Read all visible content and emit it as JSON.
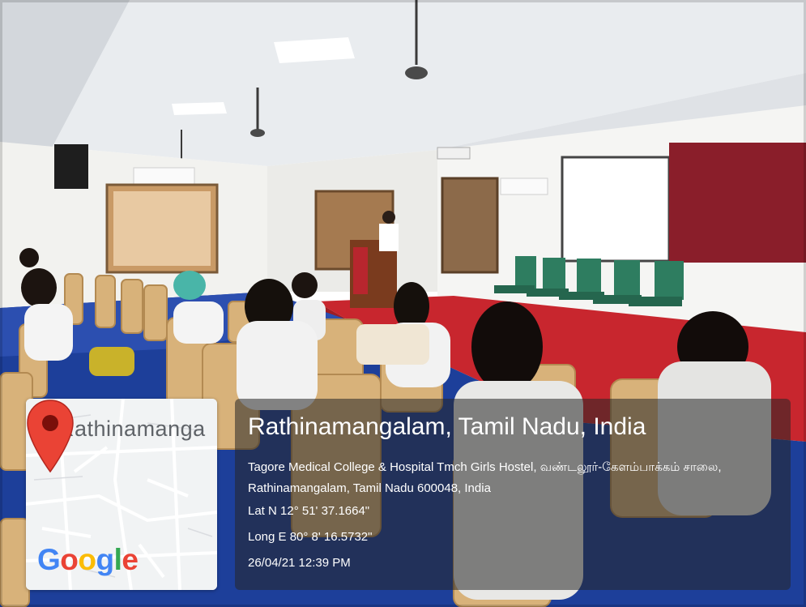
{
  "map": {
    "place_label": "Rathinamanga",
    "brand": [
      "G",
      "o",
      "o",
      "g",
      "l",
      "e"
    ],
    "brand_colors": [
      "#4285F4",
      "#EA4335",
      "#FBBC05",
      "#4285F4",
      "#34A853",
      "#EA4335"
    ],
    "pin_color": "#EA4335",
    "pin_icon": "map-pin-icon"
  },
  "overlay": {
    "title": "Rathinamangalam, Tamil Nadu, India",
    "address": "Tagore Medical College & Hospital Tmch Girls Hostel, வண்டலூர்-கேளம்பாக்கம் சாலை, Rathinamangalam, Tamil Nadu 600048, India",
    "lat": "Lat N 12° 51' 37.1664\"",
    "long": "Long E 80° 8' 16.5732\"",
    "timestamp": "26/04/21 12:39 PM"
  }
}
